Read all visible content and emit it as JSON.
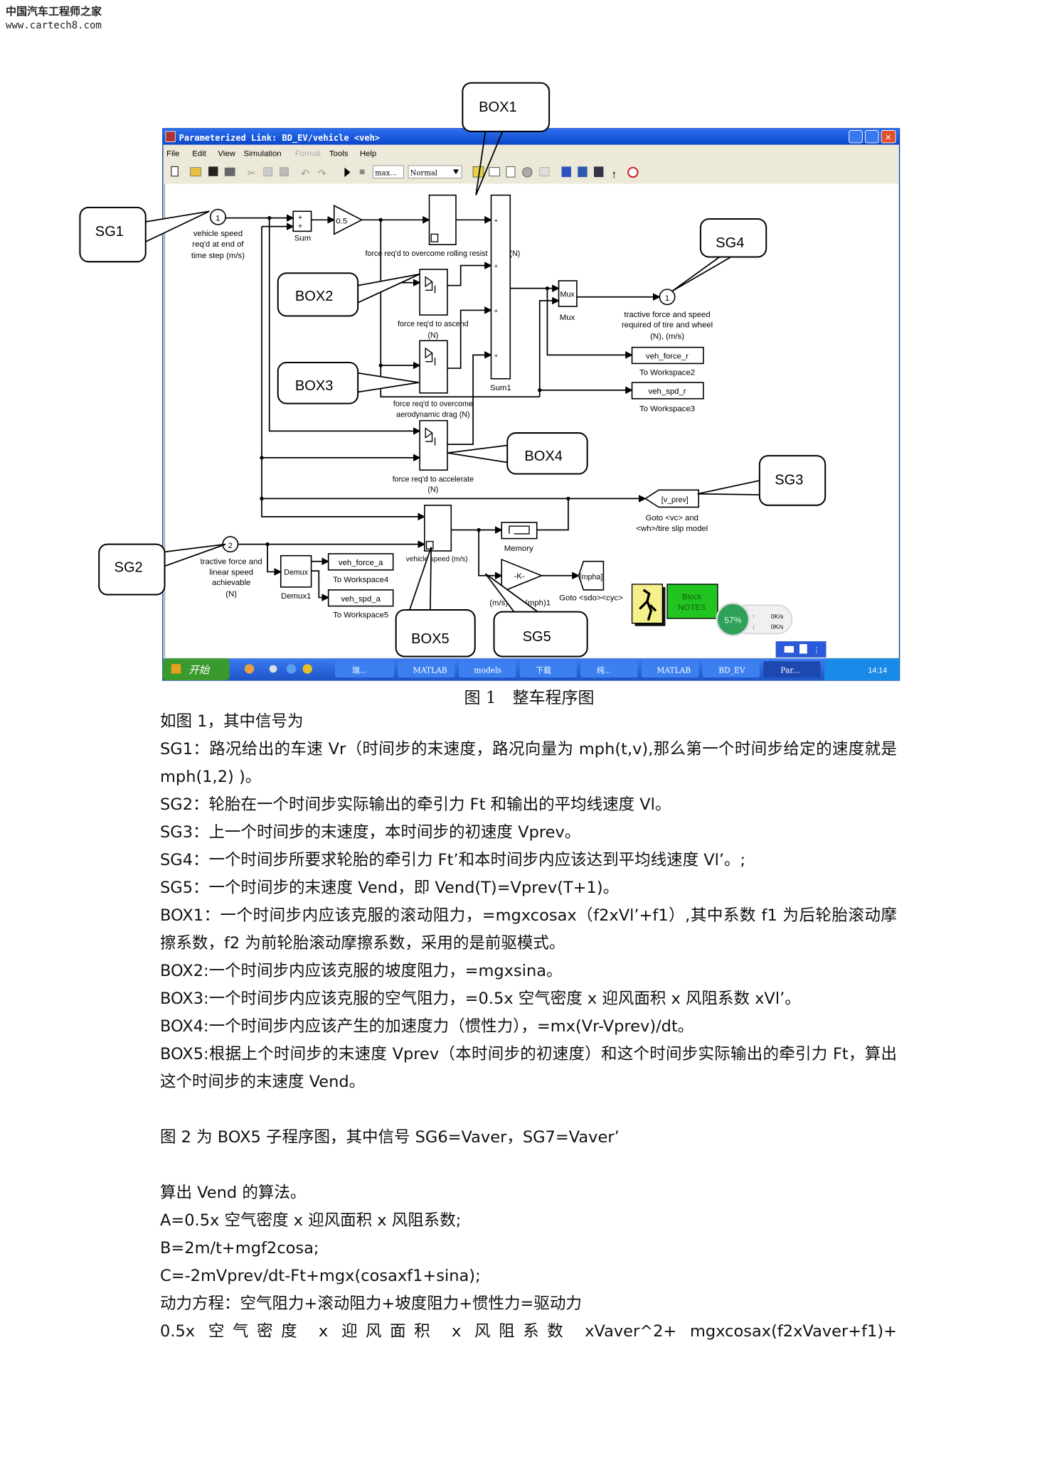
{
  "watermark": {
    "name": "中国汽车工程师之家",
    "url": "www.cartech8.com"
  },
  "window": {
    "title": "Parameterized Link: BD_EV/vehicle <veh>",
    "menu": [
      "File",
      "Edit",
      "View",
      "Simulation",
      "Format",
      "Tools",
      "Help"
    ],
    "toolbar": {
      "stop_time": "max...",
      "sim_mode": "Normal"
    }
  },
  "diagram": {
    "callouts": {
      "box1": "BOX1",
      "box2": "BOX2",
      "box3": "BOX3",
      "box4": "BOX4",
      "box5": "BOX5",
      "sg1": "SG1",
      "sg2": "SG2",
      "sg3": "SG3",
      "sg4": "SG4",
      "sg5": "SG5"
    },
    "inport1": {
      "num": "1",
      "label": [
        "vehicle speed",
        "req'd at end of",
        "time step (m/s)"
      ]
    },
    "inport2": {
      "num": "2",
      "label": [
        "tractive force and",
        "linear speed",
        "achievable",
        "(N)"
      ]
    },
    "outport1": {
      "num": "1",
      "label": [
        "tractive force and speed",
        "required of tire and wheel",
        "(N), (m/s)"
      ]
    },
    "sum": "Sum",
    "gain": "0.5",
    "sum1": "Sum1",
    "rolling_label": "force req'd to overcome rolling resist",
    "rolling_unit": "(N)",
    "ascend_label": [
      "force req'd to ascend",
      "(N)"
    ],
    "drag_label": [
      "force req'd to overcome",
      "aerodynamic drag (N)"
    ],
    "accel_label": [
      "force req'd to accelerate",
      "(N)"
    ],
    "mux": "Mux",
    "mux_label": "Mux",
    "ws2": {
      "var": "veh_force_r",
      "label": "To Workspace2"
    },
    "ws3": {
      "var": "veh_spd_r",
      "label": "To Workspace3"
    },
    "ws4": {
      "var": "veh_force_a",
      "label": "To Workspace4"
    },
    "ws5": {
      "var": "veh_spd_a",
      "label": "To Workspace5"
    },
    "demux": "Demux",
    "demux_label": "Demux1",
    "goto_vprev": {
      "tag": "[v_prev]",
      "label": [
        "Goto <vc> and",
        "<wh>/tire slip model"
      ]
    },
    "vehicle_speed_label": "vehicle speed (m/s)",
    "memory_label": "Memory",
    "gain_k": "-K-",
    "ms_label": "(m/s)",
    "mph_label": "(mph)1",
    "goto_mpha": {
      "tag": "[mpha]",
      "label": "Goto <sdo><cyc>"
    },
    "notes": [
      "Block",
      "NOTES"
    ],
    "net_widget": {
      "percent": "57%",
      "up": "0K/s",
      "down": "0K/s"
    }
  },
  "taskbar": {
    "start": "开始",
    "items": [
      "瑞...",
      "MATLAB",
      "models",
      "下载",
      "纯...",
      "MATLAB",
      "BD_EV",
      "Par..."
    ],
    "clock": "14:14"
  },
  "caption": "图 1　整车程序图",
  "paragraphs": [
    "如图 1，其中信号为",
    "SG1：路况给出的车速 Vr（时间步的末速度，路况向量为 mph(t,v),那么第一个时间步给定的速度就是 mph(1,2) )。",
    "SG2：轮胎在一个时间步实际输出的牵引力 Ft 和输出的平均线速度 Vl。",
    "SG3：上一个时间步的末速度，本时间步的初速度 Vprev。",
    "SG4：一个时间步所要求轮胎的牵引力 Ft’和本时间步内应该达到平均线速度 Vl’。;",
    "SG5：一个时间步的末速度 Vend，即 Vend(T)=Vprev(T+1)。",
    "BOX1：一个时间步内应该克服的滚动阻力，=mgxcosax（f2xVl’+f1）,其中系数 f1 为后轮胎滚动摩擦系数，f2 为前轮胎滚动摩擦系数，采用的是前驱模式。",
    "BOX2:一个时间步内应该克服的坡度阻力，=mgxsina。",
    "BOX3:一个时间步内应该克服的空气阻力，=0.5x 空气密度 x 迎风面积 x 风阻系数 xVl’。",
    "BOX4:一个时间步内应该产生的加速度力（惯性力），=mx(Vr-Vprev)/dt。",
    "BOX5:根据上个时间步的末速度 Vprev（本时间步的初速度）和这个时间步实际输出的牵引力 Ft，算出这个时间步的末速度 Vend。",
    "图 2 为 BOX5 子程序图，其中信号 SG6=Vaver，SG7=Vaver’",
    "算出 Vend 的算法。",
    "A=0.5x 空气密度 x 迎风面积 x 风阻系数;",
    "B=2m/t+mgf2cosa;",
    "C=-2mVprev/dt-Ft+mgx(cosaxf1+sina);",
    "动力方程：空气阻力+滚动阻力+坡度阻力+惯性力=驱动力",
    "0.5x 空气密度 x 迎风面积 x 风阻系数 xVaver^2+ mgxcosax(f2xVaver+f1)+"
  ],
  "colors": {
    "titlebar": "#0a4fd8",
    "taskbar": "#2a63d8",
    "start": "#3a9a2e",
    "notes": "#22c422",
    "mascot": "#f4f08a"
  }
}
